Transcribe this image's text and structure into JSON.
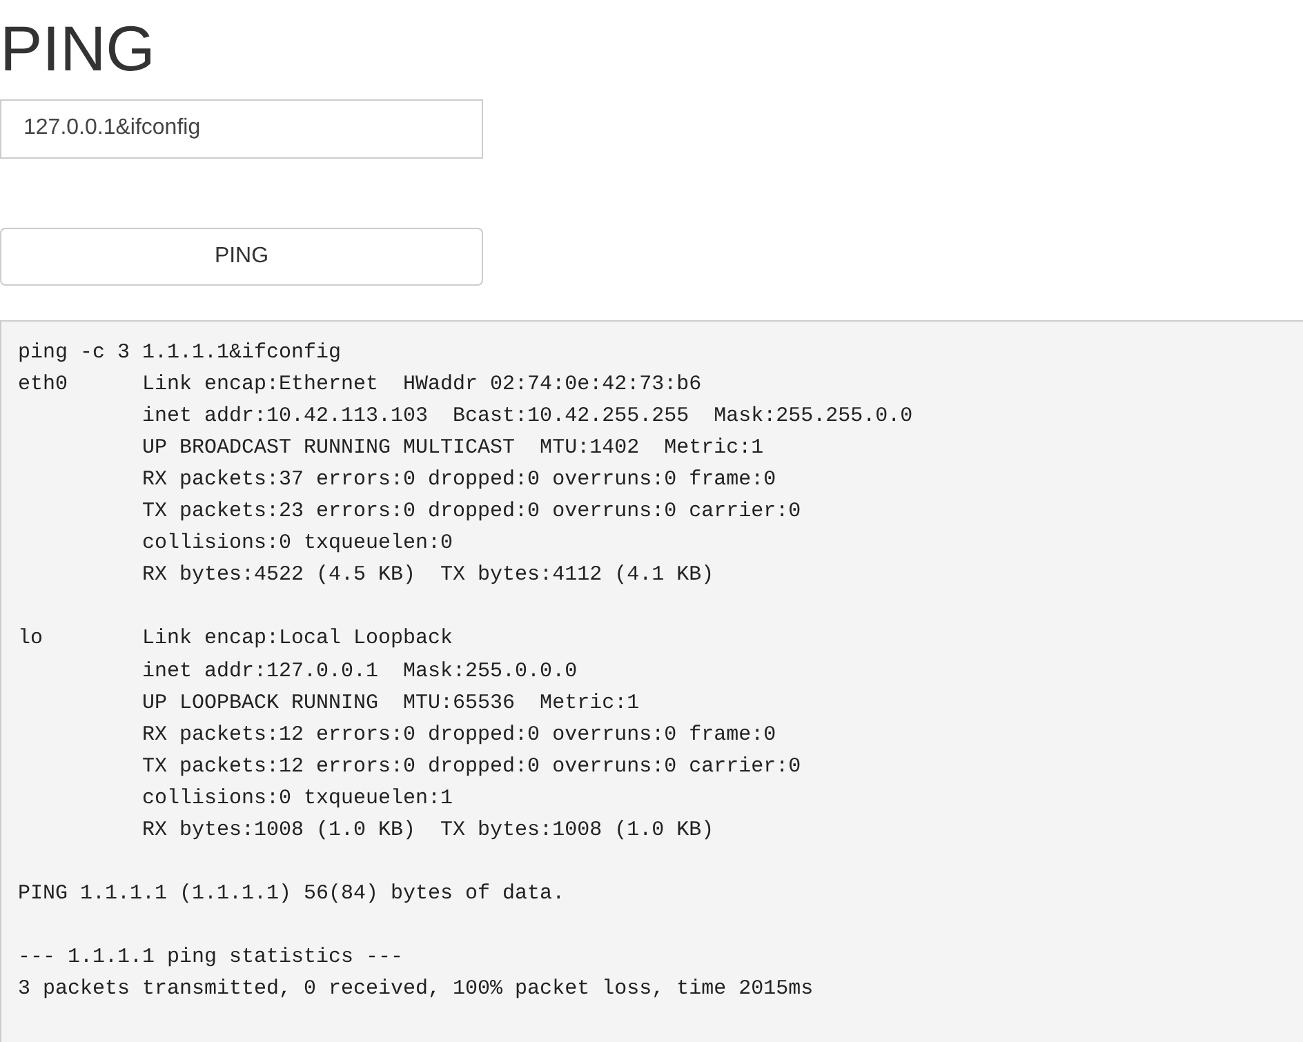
{
  "title": "PING",
  "host_input": {
    "value": "127.0.0.1&ifconfig"
  },
  "ping_button": {
    "label": "PING"
  },
  "output": {
    "blocks": [
      {
        "lines": [
          "ping -c 3 1.1.1.1&ifconfig",
          "eth0      Link encap:Ethernet  HWaddr 02:74:0e:42:73:b6",
          "          inet addr:10.42.113.103  Bcast:10.42.255.255  Mask:255.255.0.0",
          "          UP BROADCAST RUNNING MULTICAST  MTU:1402  Metric:1",
          "          RX packets:37 errors:0 dropped:0 overruns:0 frame:0",
          "          TX packets:23 errors:0 dropped:0 overruns:0 carrier:0",
          "          collisions:0 txqueuelen:0",
          "          RX bytes:4522 (4.5 KB)  TX bytes:4112 (4.1 KB)"
        ]
      },
      {
        "lines": [
          "lo        Link encap:Local Loopback",
          "          inet addr:127.0.0.1  Mask:255.0.0.0",
          "          UP LOOPBACK RUNNING  MTU:65536  Metric:1",
          "          RX packets:12 errors:0 dropped:0 overruns:0 frame:0",
          "          TX packets:12 errors:0 dropped:0 overruns:0 carrier:0",
          "          collisions:0 txqueuelen:1",
          "          RX bytes:1008 (1.0 KB)  TX bytes:1008 (1.0 KB)"
        ]
      },
      {
        "lines": [
          "PING 1.1.1.1 (1.1.1.1) 56(84) bytes of data."
        ]
      },
      {
        "lines": [
          "--- 1.1.1.1 ping statistics ---",
          "3 packets transmitted, 0 received, 100% packet loss, time 2015ms"
        ]
      }
    ]
  }
}
